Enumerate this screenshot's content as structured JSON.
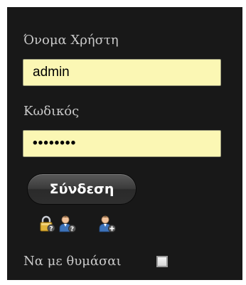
{
  "form": {
    "username_label": "Όνομα Χρήστη",
    "username_value": "admin",
    "password_label": "Κωδικός",
    "password_value": "••••••••",
    "login_button": "Σύνδεση",
    "remember_label": "Να με θυμάσαι",
    "remember_checked": false
  },
  "icons": [
    {
      "name": "lost-password-icon"
    },
    {
      "name": "lost-username-icon"
    },
    {
      "name": "register-user-icon"
    }
  ],
  "colors": {
    "panel_bg": "#181818",
    "label_text": "#c9c9c9",
    "input_bg": "#fbf7b4",
    "button_text": "#ffffff"
  }
}
